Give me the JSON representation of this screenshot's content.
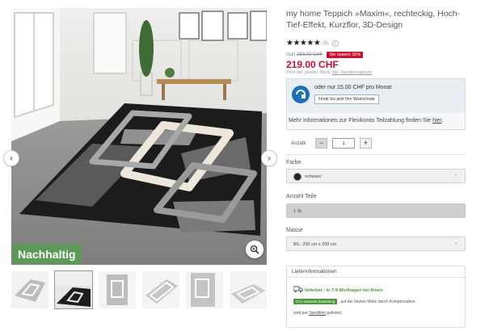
{
  "product": {
    "title": "my home Teppich »Maxim«, rechteckig, Hoch-Tief-Effekt, Kurzflor, 3D-Design",
    "stars": "★★★★★",
    "rating_count": "(6)",
    "old_price_prefix": "statt",
    "old_price": "259.00 CHF",
    "save_badge": "Sie sparen 15%",
    "price": "219.00 CHF",
    "price_note_prefix": "Preis inkl. gesetzl. MwSt.",
    "price_note_link": "inkl. Speditionsgebühr"
  },
  "gallery": {
    "badge": "Nachhaltig",
    "prev_arrow": "‹",
    "next_arrow": "›",
    "thumbnail_count": 6
  },
  "finance": {
    "monthly_text": "oder nur 15.00 CHF pro Monat",
    "button_label": "Finde Sie jetzt Ihre Wunschrate",
    "more_text": "Mehr Informationen zur Flexikonto Teilzahlung finden Sie ",
    "more_link": "hier",
    "more_suffix": "."
  },
  "quantity": {
    "label": "Anzahl",
    "minus": "−",
    "plus": "+",
    "value": "1"
  },
  "options": {
    "color_label": "Farbe",
    "color_value": "schwarz",
    "parts_label": "Anzahl Teile",
    "parts_value": "1 St.",
    "size_label": "Masse",
    "size_value": "B/L: 200 cm x 200 cm",
    "chevron": "›"
  },
  "delivery": {
    "heading": "Lieferinformationen",
    "time": "lieferbar - in 7-9 Werktagen bei Ihnen",
    "co2_badge": "CO₂-neutrale Zustellung",
    "co2_text": "auf der letzten Meile durch Kompensation",
    "by_prefix": "wird per ",
    "by_link": "Spedition",
    "by_suffix": " geliefert."
  },
  "colors": {
    "price_red": "#c8102e",
    "badge_green": "#5a9a54",
    "finance_blue": "#1d6fb8"
  },
  "icons": [
    "chevron-left-icon",
    "chevron-right-icon",
    "zoom-icon",
    "info-icon",
    "finance-icon",
    "truck-icon"
  ]
}
